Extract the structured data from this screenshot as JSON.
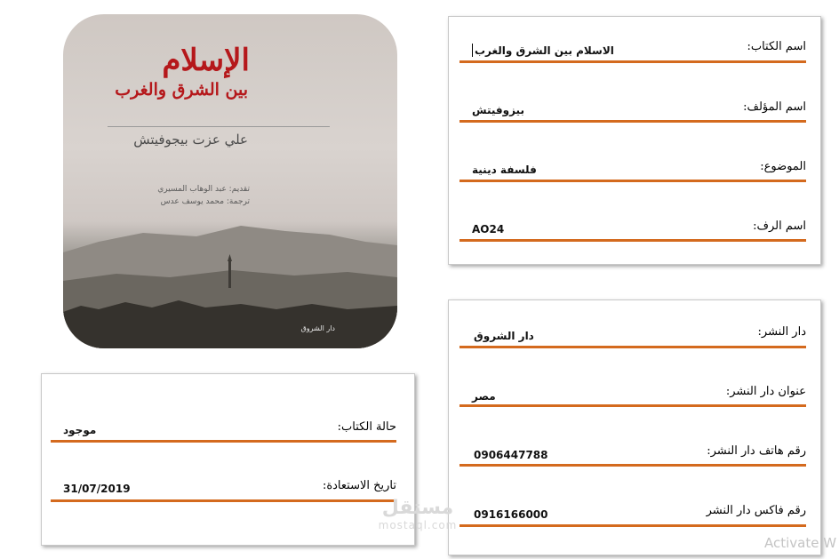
{
  "cover": {
    "title": "الإسلام",
    "subtitle": "بين الشرق والغرب",
    "author": "علي عزت بيجوفيتش",
    "credit_intro": "تقديم: عبد الوهاب المسيري",
    "credit_translation": "ترجمة: محمد يوسف عدس",
    "imprint": "دار الشروق"
  },
  "book_panel": {
    "title_label": "اسم الكتاب:",
    "title_value": "الاسلام بين الشرق والغرب",
    "author_label": "اسم المؤلف:",
    "author_value": "بيزوفيتش",
    "subject_label": "الموضوع:",
    "subject_value": "فلسفة دينية",
    "shelf_label": "اسم الرف:",
    "shelf_value": "AO24"
  },
  "publisher_panel": {
    "name_label": "دار النشر:",
    "name_value": "دار الشروق",
    "address_label": "عنوان دار النشر:",
    "address_value": "مصر",
    "phone_label": "رقم هاتف دار النشر:",
    "phone_value": "0906447788",
    "fax_label": "رقم فاكس دار النشر",
    "fax_value": "0916166000"
  },
  "status_panel": {
    "status_label": "حالة الكتاب:",
    "status_value": "موجود",
    "return_label": "تاريخ الاستعادة:",
    "return_value": "31/07/2019"
  },
  "watermark": {
    "arabic": "مستقل",
    "latin": "mostaql.com"
  },
  "system": {
    "activation_text": "Activate W"
  },
  "colors": {
    "field_underline": "#d46a1e",
    "cover_title": "#b5181b"
  }
}
